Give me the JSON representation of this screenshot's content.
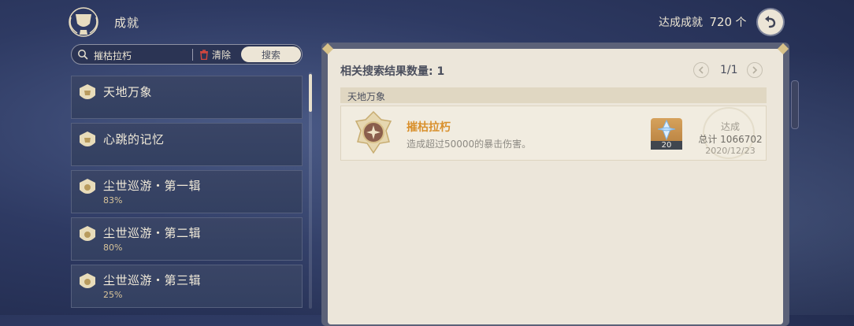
{
  "header": {
    "title": "成就",
    "achievement_label": "达成成就",
    "achievement_count": "720",
    "achievement_unit": "个"
  },
  "search": {
    "query": "摧枯拉朽",
    "clear_label": "清除",
    "search_label": "搜索"
  },
  "categories": [
    {
      "name": "天地万象",
      "progress": ""
    },
    {
      "name": "心跳的记忆",
      "progress": ""
    },
    {
      "name": "尘世巡游・第一辑",
      "progress": "83%"
    },
    {
      "name": "尘世巡游・第二辑",
      "progress": "80%"
    },
    {
      "name": "尘世巡游・第三辑",
      "progress": "25%"
    }
  ],
  "results": {
    "count_label": "相关搜索结果数量: 1",
    "page": "1/1",
    "group_name": "天地万象",
    "item": {
      "title": "摧枯拉朽",
      "description": "造成超过50000的暴击伤害。",
      "reward_qty": "20",
      "status": "达成",
      "total": "总计 1066702",
      "date": "2020/12/23"
    }
  },
  "colors": {
    "accent_gold": "#d9902d",
    "panel_bg": "#ece6da",
    "list_item_bg": "#3a4566"
  }
}
